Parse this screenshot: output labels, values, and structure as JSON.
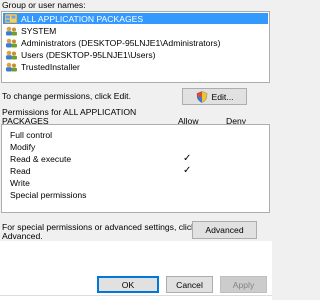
{
  "groups_label": "Group or user names:",
  "users": [
    {
      "name": "ALL APPLICATION PACKAGES",
      "selected": true
    },
    {
      "name": "SYSTEM",
      "selected": false
    },
    {
      "name": "Administrators (DESKTOP-95LNJE1\\Administrators)",
      "selected": false
    },
    {
      "name": "Users (DESKTOP-95LNJE1\\Users)",
      "selected": false
    },
    {
      "name": "TrustedInstaller",
      "selected": false
    }
  ],
  "change_text": "To change permissions, click Edit.",
  "edit_button": "Edit...",
  "permissions_header": {
    "line1": "Permissions for ALL APPLICATION",
    "line2": "PACKAGES",
    "allow": "Allow",
    "deny": "Deny"
  },
  "permissions": [
    {
      "name": "Full control",
      "allow": false,
      "deny": false
    },
    {
      "name": "Modify",
      "allow": false,
      "deny": false
    },
    {
      "name": "Read & execute",
      "allow": true,
      "deny": false
    },
    {
      "name": "Read",
      "allow": true,
      "deny": false
    },
    {
      "name": "Write",
      "allow": false,
      "deny": false
    },
    {
      "name": "Special permissions",
      "allow": false,
      "deny": false
    }
  ],
  "check_glyph": "✓",
  "special_text_line1": "For special permissions or advanced settings, click",
  "special_text_line2": "Advanced.",
  "advanced_button": "Advanced",
  "footer": {
    "ok": "OK",
    "cancel": "Cancel",
    "apply": "Apply"
  },
  "colors": {
    "selection": "#3399ff",
    "button_border_default": "#0078d7"
  }
}
